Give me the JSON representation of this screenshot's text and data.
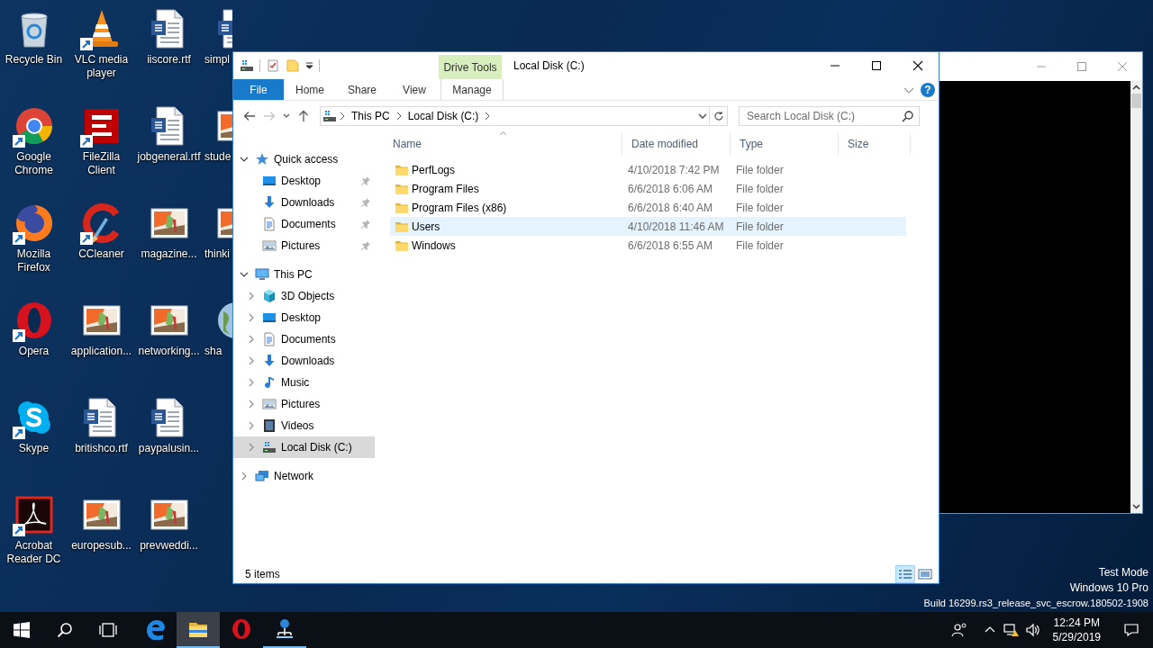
{
  "desktop": {
    "icons": [
      {
        "label": "Recycle Bin",
        "kind": "recycle-bin",
        "shortcut": false
      },
      {
        "label": "Google Chrome",
        "kind": "chrome",
        "shortcut": true
      },
      {
        "label": "Mozilla Firefox",
        "kind": "firefox",
        "shortcut": true
      },
      {
        "label": "Opera",
        "kind": "opera",
        "shortcut": true
      },
      {
        "label": "Skype",
        "kind": "skype",
        "shortcut": true
      },
      {
        "label": "Acrobat Reader DC",
        "kind": "acrobat",
        "shortcut": true
      },
      {
        "label": "VLC media player",
        "kind": "vlc",
        "shortcut": true
      },
      {
        "label": "FileZilla Client",
        "kind": "filezilla",
        "shortcut": true
      },
      {
        "label": "CCleaner",
        "kind": "ccleaner",
        "shortcut": true
      },
      {
        "label": "application...",
        "kind": "image",
        "shortcut": false
      },
      {
        "label": "britishco.rtf",
        "kind": "document",
        "shortcut": false
      },
      {
        "label": "europesub...",
        "kind": "image",
        "shortcut": false
      },
      {
        "label": "iiscore.rtf",
        "kind": "document",
        "shortcut": false
      },
      {
        "label": "jobgeneral.rtf",
        "kind": "document",
        "shortcut": false
      },
      {
        "label": "magazine...",
        "kind": "image",
        "shortcut": false
      },
      {
        "label": "networking...",
        "kind": "image",
        "shortcut": false
      },
      {
        "label": "paypalusin...",
        "kind": "document",
        "shortcut": false
      },
      {
        "label": "prevweddi...",
        "kind": "image",
        "shortcut": false
      },
      {
        "label": "simpl",
        "kind": "document",
        "shortcut": false
      },
      {
        "label": "stude",
        "kind": "image",
        "shortcut": false
      },
      {
        "label": "thinki",
        "kind": "image",
        "shortcut": false
      },
      {
        "label": "sha",
        "kind": "globe",
        "shortcut": false
      }
    ],
    "notice": [
      "Test Mode",
      "Windows 10 Pro",
      "Build 16299.rs3_release_svc_escrow.180502-1908"
    ]
  },
  "explorer": {
    "title": "Local Disk (C:)",
    "ribbon_tabs": [
      {
        "label": "File",
        "kind": "file",
        "selected": false
      },
      {
        "label": "Home",
        "kind": "plain",
        "selected": false
      },
      {
        "label": "Share",
        "kind": "plain",
        "selected": false
      },
      {
        "label": "View",
        "kind": "plain",
        "selected": false
      },
      {
        "label": "Manage",
        "kind": "contextual",
        "context": "Drive Tools",
        "selected": false
      }
    ],
    "help": "?",
    "navigation": [
      {
        "kind": "back",
        "disabled": false
      },
      {
        "kind": "forward",
        "disabled": true
      },
      {
        "kind": "recent",
        "disabled": false
      },
      {
        "kind": "up",
        "disabled": false
      }
    ],
    "breadcrumbs": [
      "This PC",
      "Local Disk (C:)"
    ],
    "search": {
      "placeholder": "Search Local Disk (C:)"
    },
    "nav_pane": [
      {
        "label": "Quick access",
        "kind": "star",
        "expanded": true,
        "selected": false,
        "children": [
          {
            "label": "Desktop",
            "kind": "desktop",
            "pinned": true,
            "selected": false
          },
          {
            "label": "Downloads",
            "kind": "downloads",
            "pinned": true,
            "selected": false
          },
          {
            "label": "Documents",
            "kind": "documents",
            "pinned": true,
            "selected": false
          },
          {
            "label": "Pictures",
            "kind": "pictures",
            "pinned": true,
            "selected": false
          }
        ]
      },
      {
        "label": "This PC",
        "kind": "pc",
        "expanded": true,
        "selected": false,
        "children": [
          {
            "label": "3D Objects",
            "kind": "cube",
            "expanded": false,
            "selected": false
          },
          {
            "label": "Desktop",
            "kind": "desktop",
            "expanded": false,
            "selected": false
          },
          {
            "label": "Documents",
            "kind": "documents",
            "expanded": false,
            "selected": false
          },
          {
            "label": "Downloads",
            "kind": "downloads",
            "expanded": false,
            "selected": false
          },
          {
            "label": "Music",
            "kind": "music",
            "expanded": false,
            "selected": false
          },
          {
            "label": "Pictures",
            "kind": "pictures",
            "expanded": false,
            "selected": false
          },
          {
            "label": "Videos",
            "kind": "videos",
            "expanded": false,
            "selected": false
          },
          {
            "label": "Local Disk (C:)",
            "kind": "drive",
            "expanded": false,
            "selected": true
          }
        ]
      },
      {
        "label": "Network",
        "kind": "network",
        "expanded": false,
        "selected": false
      }
    ],
    "columns": [
      {
        "label": "Name",
        "sorted": true
      },
      {
        "label": "Date modified",
        "sorted": false
      },
      {
        "label": "Type",
        "sorted": false
      },
      {
        "label": "Size",
        "sorted": false
      }
    ],
    "files": [
      {
        "name": "PerfLogs",
        "date_modified": "4/10/2018 7:42 PM",
        "type": "File folder",
        "selected": false
      },
      {
        "name": "Program Files",
        "date_modified": "6/6/2018 6:06 AM",
        "type": "File folder",
        "selected": false
      },
      {
        "name": "Program Files (x86)",
        "date_modified": "6/6/2018 6:40 AM",
        "type": "File folder",
        "selected": false
      },
      {
        "name": "Users",
        "date_modified": "4/10/2018 11:46 AM",
        "type": "File folder",
        "selected": true
      },
      {
        "name": "Windows",
        "date_modified": "6/6/2018 6:55 AM",
        "type": "File folder",
        "selected": false
      }
    ],
    "status": "5 items",
    "views": [
      {
        "kind": "details",
        "selected": true
      },
      {
        "kind": "large-icons",
        "selected": false
      }
    ]
  },
  "taskbar": {
    "apps": [
      {
        "kind": "edge",
        "active": false,
        "running": false
      },
      {
        "kind": "explorer",
        "active": true,
        "running": true
      },
      {
        "kind": "opera",
        "active": false,
        "running": false
      },
      {
        "kind": "network-app",
        "active": false,
        "running": true
      }
    ],
    "clock": {
      "time": "12:24 PM",
      "date": "5/29/2019"
    }
  }
}
